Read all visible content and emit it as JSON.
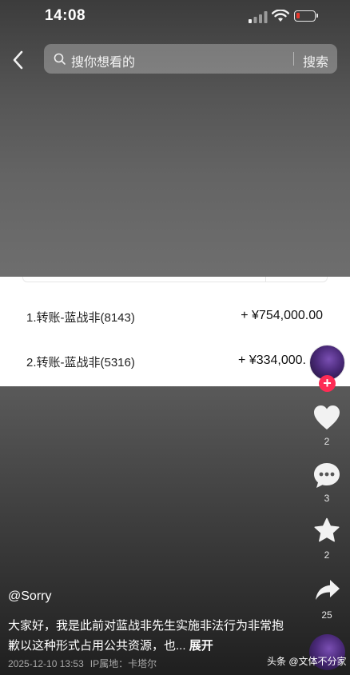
{
  "status_bar": {
    "time": "14:08"
  },
  "search": {
    "placeholder": "搜你想看的",
    "button_label": "搜索"
  },
  "transfers": [
    {
      "label": "1.转账-蓝战非(8143)",
      "amount": "+ ¥754,000.00"
    },
    {
      "label": "2.转账-蓝战非(5316)",
      "amount": "+ ¥334,000."
    }
  ],
  "actions": {
    "like_count": "2",
    "comment_count": "3",
    "favorite_count": "2",
    "share_count": "25"
  },
  "post": {
    "author": "@Sorry",
    "text": "大家好，我是此前对蓝战非先生实施非法行为非常抱歉以这种形式占用公共资源，也...",
    "more_label": "展开",
    "date": "2025-12-10 13:53",
    "ip_location": "IP属地：卡塔尔"
  },
  "watermark": "头条 @文体不分家",
  "colors": {
    "follow_badge": "#fe2c55",
    "battery_low": "#e8372c"
  }
}
